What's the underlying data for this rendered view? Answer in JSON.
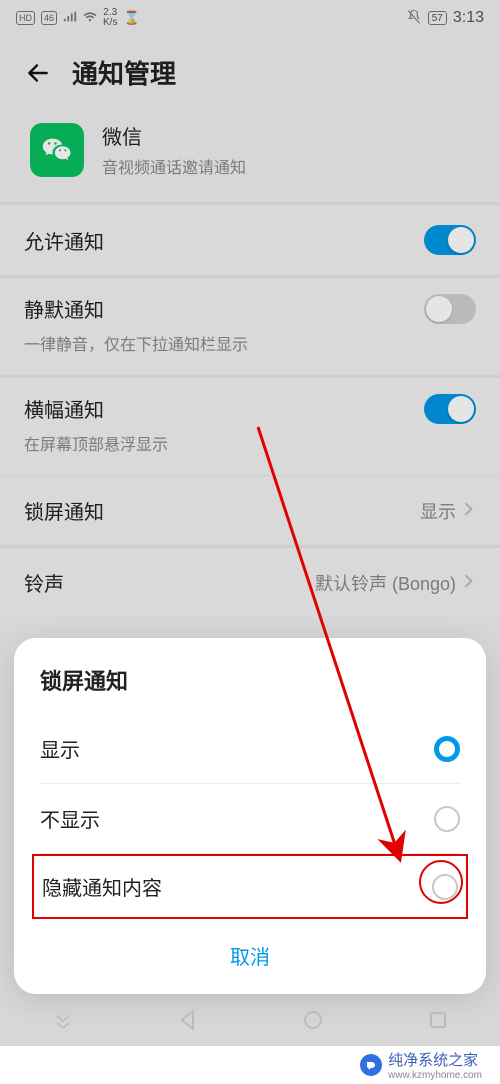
{
  "status": {
    "hd": "HD",
    "net": "46",
    "speed_val": "2.3",
    "speed_unit": "K/s",
    "battery": "57",
    "time": "3:13"
  },
  "header": {
    "title": "通知管理"
  },
  "app": {
    "name": "微信",
    "sub": "音视频通话邀请通知"
  },
  "rows": {
    "allow": {
      "title": "允许通知",
      "on": true
    },
    "silent": {
      "title": "静默通知",
      "sub": "一律静音，仅在下拉通知栏显示",
      "on": false
    },
    "banner": {
      "title": "横幅通知",
      "sub": "在屏幕顶部悬浮显示",
      "on": true
    },
    "lock": {
      "title": "锁屏通知",
      "value": "显示"
    },
    "ring": {
      "title": "铃声",
      "value": "默认铃声 (Bongo)"
    }
  },
  "sheet": {
    "title": "锁屏通知",
    "opt_show": "显示",
    "opt_hide": "不显示",
    "opt_mask": "隐藏通知内容",
    "selected": "show",
    "cancel": "取消"
  },
  "watermark": {
    "brand": "纯净系统之家",
    "url": "www.kzmyhome.com"
  }
}
